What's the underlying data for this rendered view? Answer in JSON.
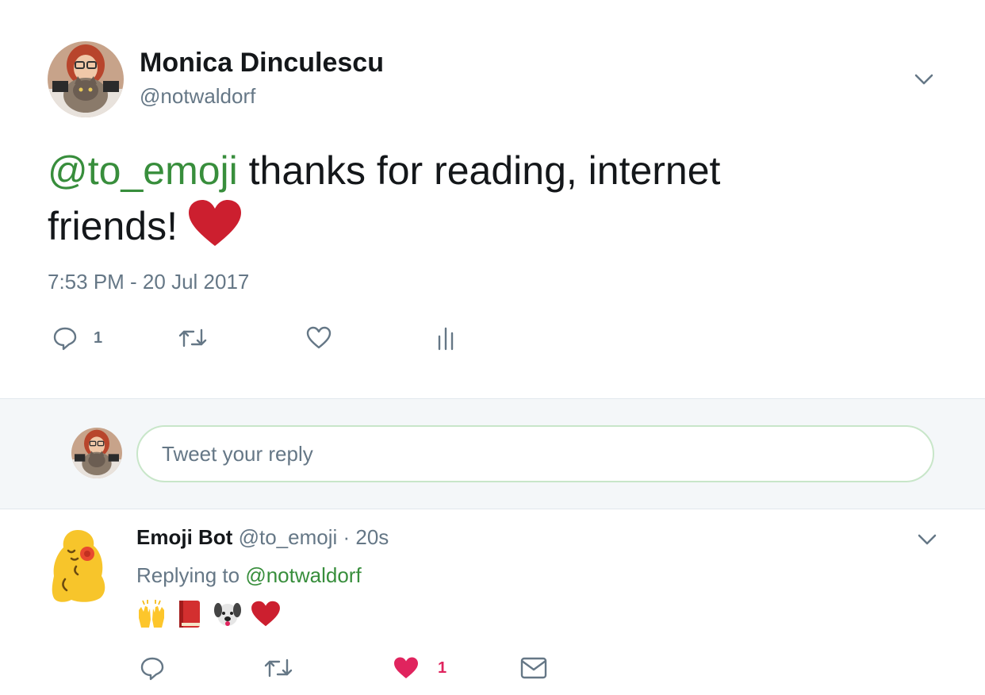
{
  "tweet": {
    "author_name": "Monica Dinculescu",
    "author_handle": "@notwaldorf",
    "mention": "@to_emoji",
    "text": " thanks for reading, internet friends!",
    "emoji": "red-heart",
    "timestamp": "7:53 PM - 20 Jul 2017",
    "reply_count": "1",
    "icons": [
      "reply-icon",
      "retweet-icon",
      "like-icon",
      "analytics-icon",
      "chevron-down-icon"
    ]
  },
  "composer": {
    "placeholder": "Tweet your reply",
    "border_color": "#c8e6c9"
  },
  "reply": {
    "author_name": "Emoji Bot",
    "author_handle": "@to_emoji",
    "separator": " · ",
    "age": "20s",
    "replying_to_label": "Replying to ",
    "replying_to_handle": "@notwaldorf",
    "emoji": [
      "raising-hands",
      "closed-book",
      "dog-face",
      "red-heart"
    ],
    "like_count": "1",
    "icons": [
      "reply-icon",
      "retweet-icon",
      "liked-heart-icon",
      "message-icon",
      "chevron-down-icon"
    ]
  },
  "colors": {
    "mention": "#388e3c",
    "text": "#14171a",
    "secondary": "#657786",
    "like_active": "#e0245e",
    "divider": "#e1e8ed",
    "composer_bg": "#f4f7f9"
  }
}
